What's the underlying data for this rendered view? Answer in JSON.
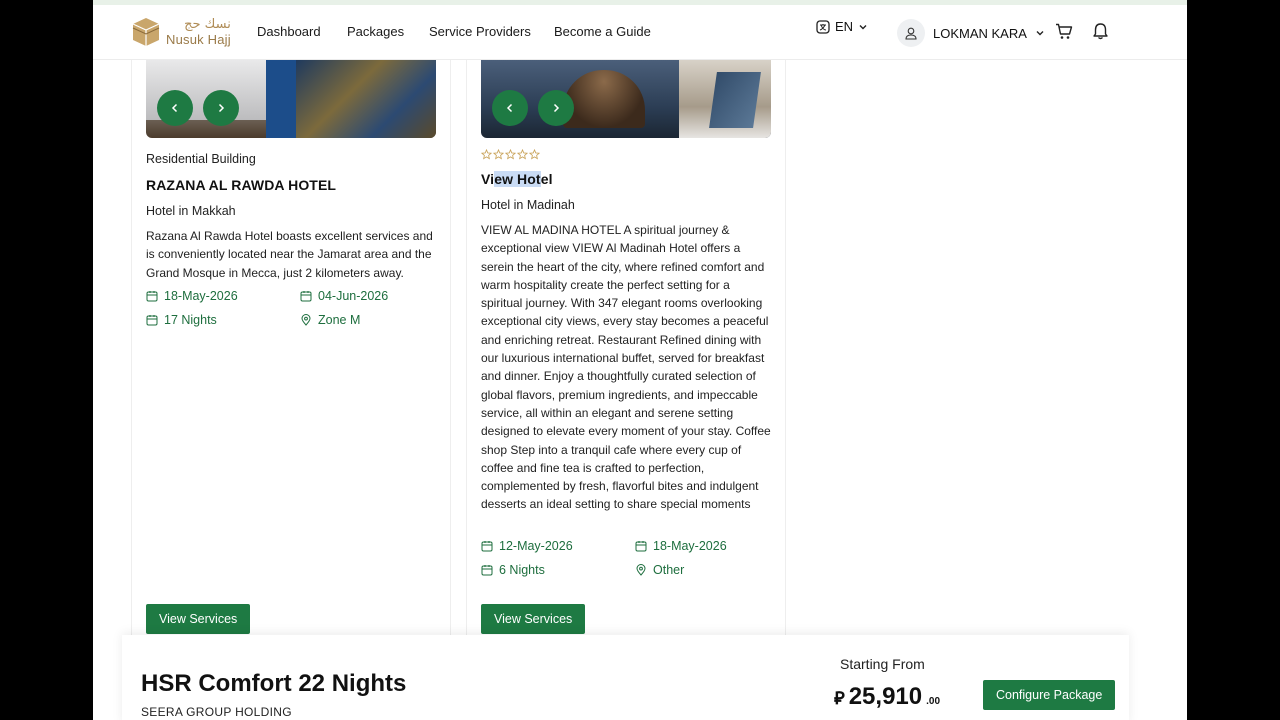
{
  "brand": {
    "name_en": "Nusuk Hajj",
    "name_ar": "نسك حج"
  },
  "nav": {
    "links": [
      "Dashboard",
      "Packages",
      "Service Providers",
      "Become a Guide"
    ],
    "language": "EN",
    "user_name": "LOKMAN KARA"
  },
  "cards": [
    {
      "type": "Residential Building",
      "title": "RAZANA AL RAWDA HOTEL",
      "subtitle": "Hotel in Makkah",
      "description": "Razana Al Rawda Hotel boasts excellent services and is conveniently located near the Jamarat area and the Grand Mosque in Mecca, just 2 kilometers away.",
      "check_in": "18-May-2026",
      "check_out": "04-Jun-2026",
      "nights": "17 Nights",
      "zone": "Zone M",
      "button": "View Services"
    },
    {
      "rating": 0,
      "title_pre": "Vi",
      "title_sel": "ew Hot",
      "title_post": "el",
      "subtitle": "Hotel in Madinah",
      "description": "VIEW AL MADINA HOTEL A spiritual journey & exceptional view VIEW Al Madinah Hotel offers a serein the heart of the city, where refined comfort and warm hospitality create the perfect setting for a spiritual journey. With 347 elegant rooms overlooking exceptional city views, every stay becomes a peaceful and enriching retreat. Restaurant Refined dining with our luxurious international buffet, served for breakfast and dinner. Enjoy a thoughtfully curated selection of global flavors, premium ingredients, and impeccable service, all within an elegant and serene setting designed to elevate every moment of your stay. Coffee shop Step into a tranquil cafe where every cup of coffee and fine tea is crafted to perfection, complemented by fresh, flavorful bites and indulgent desserts an ideal setting to share special moments",
      "check_in": "12-May-2026",
      "check_out": "18-May-2026",
      "nights": "6 Nights",
      "zone": "Other",
      "button": "View Services"
    }
  ],
  "package": {
    "title": "HSR Comfort 22 Nights",
    "organizer": "SEERA GROUP HOLDING",
    "starting_label": "Starting From",
    "currency_symbol": "⃁",
    "price_whole": "25,910",
    "price_decimal": ".00",
    "configure_button": "Configure Package"
  },
  "colors": {
    "accent": "#1e7a43",
    "meta_text": "#1e6e3e",
    "brand_gold": "#b08d57"
  }
}
